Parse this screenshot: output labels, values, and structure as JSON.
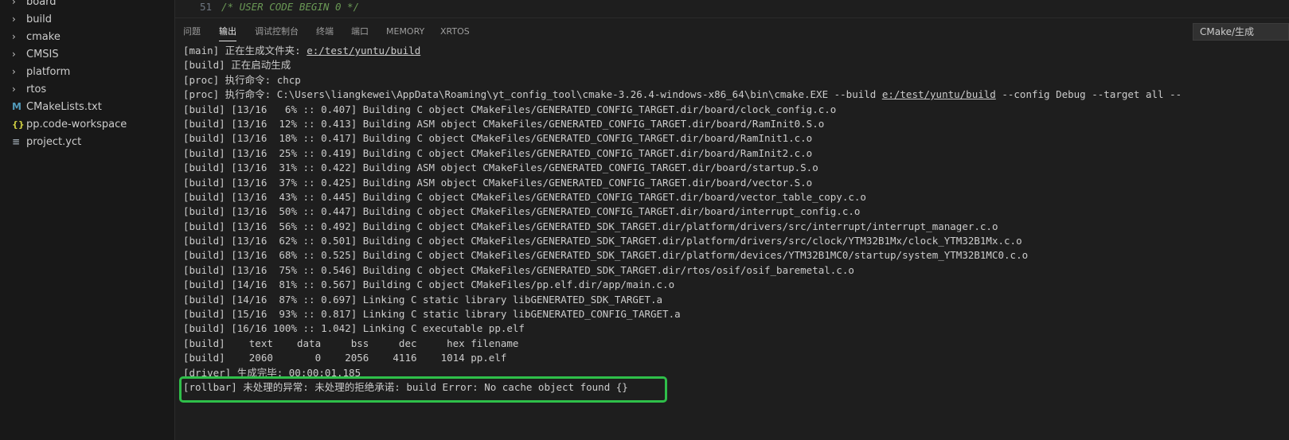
{
  "sidebar": {
    "items": [
      {
        "label": "board",
        "kind": "folder"
      },
      {
        "label": "build",
        "kind": "folder"
      },
      {
        "label": "cmake",
        "kind": "folder"
      },
      {
        "label": "CMSIS",
        "kind": "folder"
      },
      {
        "label": "platform",
        "kind": "folder"
      },
      {
        "label": "rtos",
        "kind": "folder"
      },
      {
        "label": "CMakeLists.txt",
        "kind": "file",
        "icon": "cmake-m-icon"
      },
      {
        "label": "pp.code-workspace",
        "kind": "file",
        "icon": "json-braces-icon"
      },
      {
        "label": "project.yct",
        "kind": "file",
        "icon": "lines-file-icon"
      }
    ],
    "chevron_glyph": "›",
    "icon_glyphs": {
      "cmake": "M",
      "json": "{}",
      "yct": "≡"
    }
  },
  "editor": {
    "line_number": "51",
    "code": "/* USER CODE BEGIN 0 */"
  },
  "panel": {
    "tabs": [
      {
        "label": "问题",
        "active": false
      },
      {
        "label": "输出",
        "active": true
      },
      {
        "label": "调试控制台",
        "active": false
      },
      {
        "label": "终端",
        "active": false
      },
      {
        "label": "端口",
        "active": false
      },
      {
        "label": "MEMORY",
        "active": false
      },
      {
        "label": "XRTOS",
        "active": false
      }
    ],
    "channel_select": "CMake/生成"
  },
  "output": {
    "lines": [
      {
        "pre": "[main] 正在生成文件夹: ",
        "link": "e:/test/yuntu/build",
        "post": ""
      },
      {
        "pre": "[build] 正在启动生成"
      },
      {
        "pre": "[proc] 执行命令: chcp"
      },
      {
        "pre": "[proc] 执行命令: C:\\Users\\liangkewei\\AppData\\Roaming\\yt_config_tool\\cmake-3.26.4-windows-x86_64\\bin\\cmake.EXE --build ",
        "link": "e:/test/yuntu/build",
        "post": " --config Debug --target all --"
      },
      {
        "pre": "[build] [13/16   6% :: 0.407] Building C object CMakeFiles/GENERATED_CONFIG_TARGET.dir/board/clock_config.c.o"
      },
      {
        "pre": "[build] [13/16  12% :: 0.413] Building ASM object CMakeFiles/GENERATED_CONFIG_TARGET.dir/board/RamInit0.S.o"
      },
      {
        "pre": "[build] [13/16  18% :: 0.417] Building C object CMakeFiles/GENERATED_CONFIG_TARGET.dir/board/RamInit1.c.o"
      },
      {
        "pre": "[build] [13/16  25% :: 0.419] Building C object CMakeFiles/GENERATED_CONFIG_TARGET.dir/board/RamInit2.c.o"
      },
      {
        "pre": "[build] [13/16  31% :: 0.422] Building ASM object CMakeFiles/GENERATED_CONFIG_TARGET.dir/board/startup.S.o"
      },
      {
        "pre": "[build] [13/16  37% :: 0.425] Building ASM object CMakeFiles/GENERATED_CONFIG_TARGET.dir/board/vector.S.o"
      },
      {
        "pre": "[build] [13/16  43% :: 0.445] Building C object CMakeFiles/GENERATED_CONFIG_TARGET.dir/board/vector_table_copy.c.o"
      },
      {
        "pre": "[build] [13/16  50% :: 0.447] Building C object CMakeFiles/GENERATED_CONFIG_TARGET.dir/board/interrupt_config.c.o"
      },
      {
        "pre": "[build] [13/16  56% :: 0.492] Building C object CMakeFiles/GENERATED_SDK_TARGET.dir/platform/drivers/src/interrupt/interrupt_manager.c.o"
      },
      {
        "pre": "[build] [13/16  62% :: 0.501] Building C object CMakeFiles/GENERATED_SDK_TARGET.dir/platform/drivers/src/clock/YTM32B1Mx/clock_YTM32B1Mx.c.o"
      },
      {
        "pre": "[build] [13/16  68% :: 0.525] Building C object CMakeFiles/GENERATED_SDK_TARGET.dir/platform/devices/YTM32B1MC0/startup/system_YTM32B1MC0.c.o"
      },
      {
        "pre": "[build] [13/16  75% :: 0.546] Building C object CMakeFiles/GENERATED_SDK_TARGET.dir/rtos/osif/osif_baremetal.c.o"
      },
      {
        "pre": "[build] [14/16  81% :: 0.567] Building C object CMakeFiles/pp.elf.dir/app/main.c.o"
      },
      {
        "pre": "[build] [14/16  87% :: 0.697] Linking C static library libGENERATED_SDK_TARGET.a"
      },
      {
        "pre": "[build] [15/16  93% :: 0.817] Linking C static library libGENERATED_CONFIG_TARGET.a"
      },
      {
        "pre": "[build] [16/16 100% :: 1.042] Linking C executable pp.elf"
      },
      {
        "pre": "[build]    text    data     bss     dec     hex filename"
      },
      {
        "pre": "[build]    2060       0    2056    4116    1014 pp.elf"
      },
      {
        "pre": "[driver] 生成完毕: 00:00:01.185"
      },
      {
        "pre": "[rollbar] 未处理的异常: 未处理的拒绝承诺: build Error: No cache object found {}"
      }
    ]
  },
  "colors": {
    "background": "#1e1e1e",
    "sidebar": "#181818",
    "text": "#cccccc",
    "comment": "#6a9955",
    "highlight_box": "#2fbf4a"
  }
}
